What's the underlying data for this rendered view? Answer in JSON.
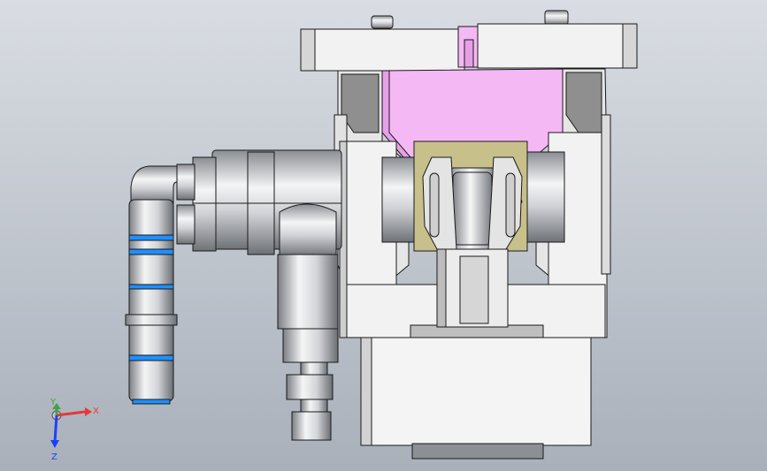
{
  "view": {
    "background": {
      "top": "#d9dde3",
      "bottom": "#a9b0ba"
    }
  },
  "triad": {
    "x_label": "X",
    "y_label": "Y",
    "z_label": "Z",
    "colors": {
      "x": "#e53935",
      "y": "#43a047",
      "z": "#1e40ff"
    }
  },
  "model": {
    "colors": {
      "body": "#f2f2f2",
      "body_shade": "#d9d9d9",
      "edge": "#1a1a1a",
      "pink": "#f4b8f4",
      "pink_shade": "#e79fe7",
      "metal": "#c9cbcf",
      "metal_dark": "#7d8086",
      "olive": "#c7c08a",
      "blue_ring": "#1f8fff"
    }
  }
}
